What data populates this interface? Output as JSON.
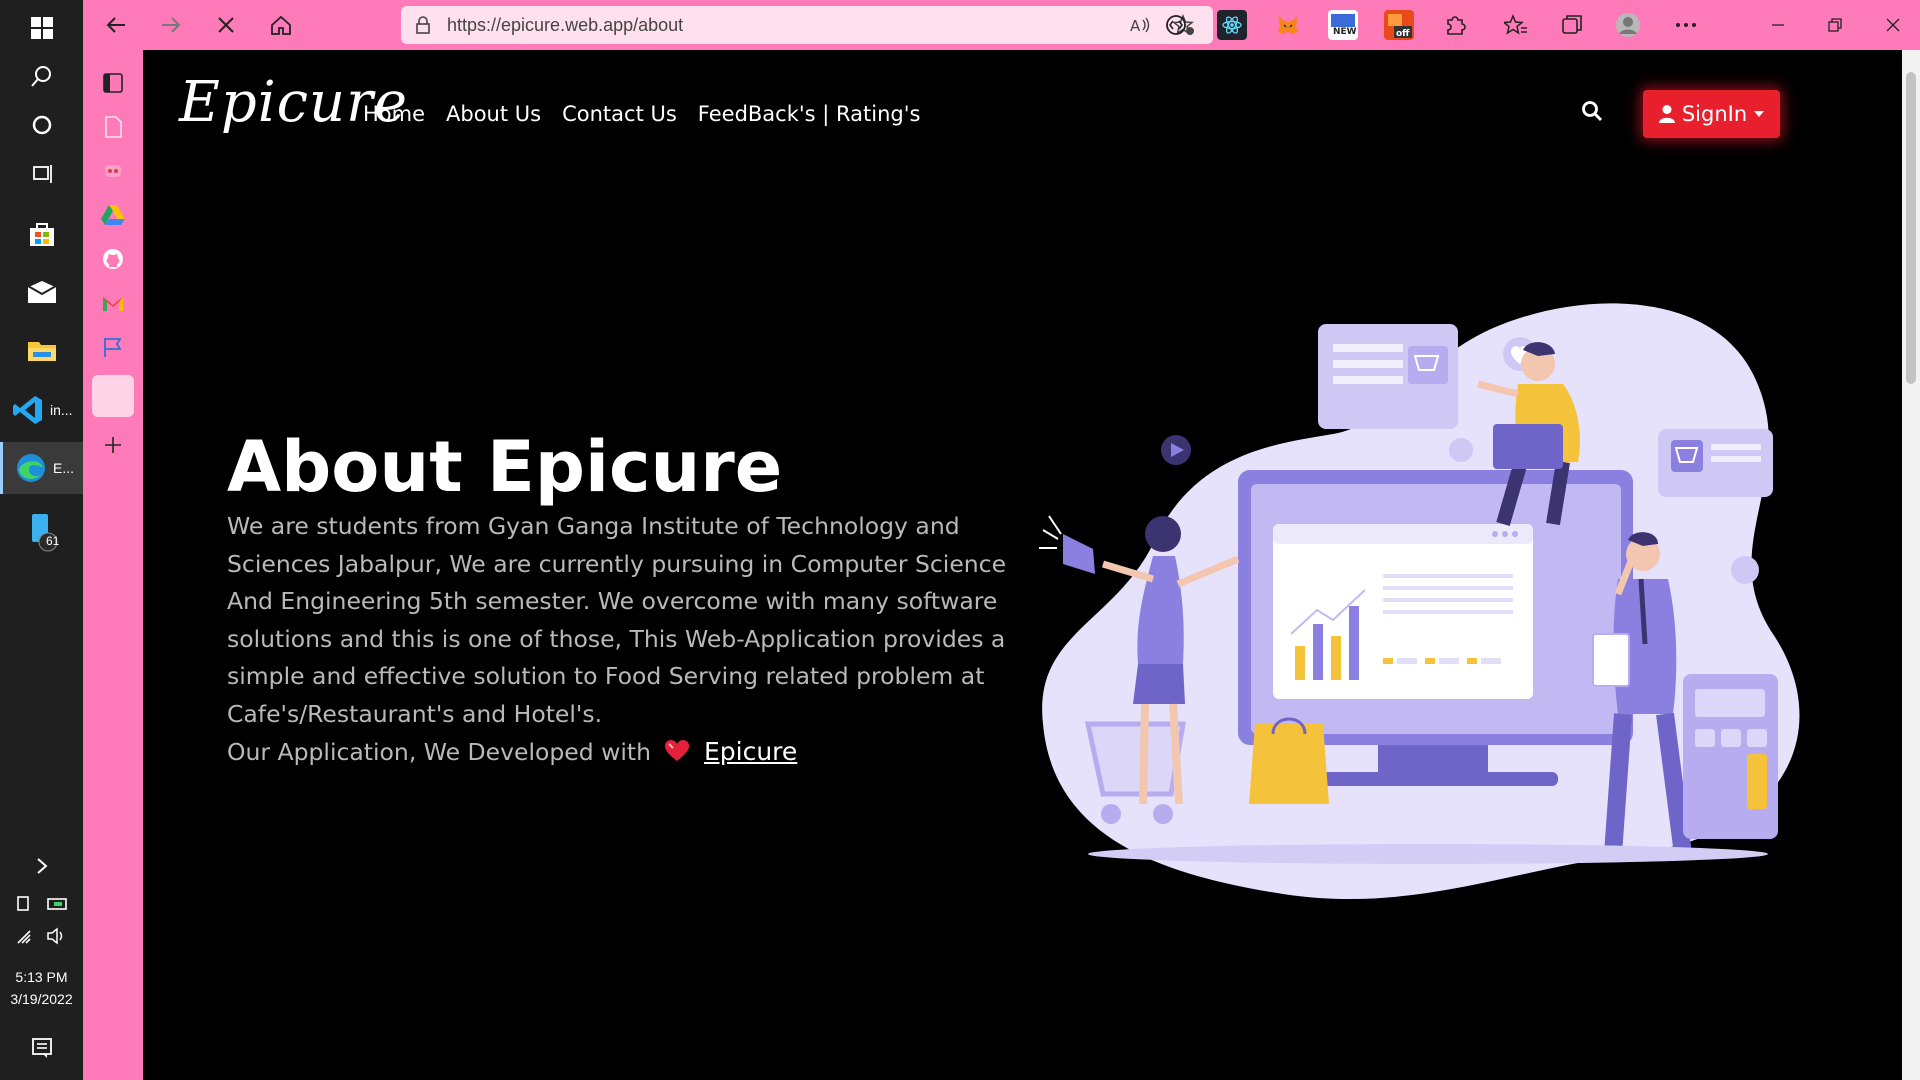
{
  "taskbar": {
    "apps": [
      {
        "label": "in..."
      },
      {
        "label": "E..."
      }
    ],
    "badge": "61",
    "time": "5:13 PM",
    "date": "3/19/2022"
  },
  "browser": {
    "url": "https://epicure.web.app/about",
    "extensions": [
      "NEW",
      "off"
    ]
  },
  "site": {
    "logo": "Epicure",
    "nav": [
      "Home",
      "About Us",
      "Contact Us",
      "FeedBack's | Rating's"
    ],
    "signin_label": "SignIn",
    "title": "About Epicure",
    "description": "We are students from Gyan Ganga Institute of Technology and Sciences Jabalpur, We are currently pursuing in Computer Science And Engineering 5th semester. We overcome with many software solutions and this is one of those, This Web-Application provides a simple and effective solution to Food Serving related problem at Cafe's/Restaurant's and Hotel's.",
    "developed_prefix": "Our Application, We Developed with",
    "brand_link": "Epicure"
  },
  "colors": {
    "browser_chrome": "#ff7ab8",
    "signin_button": "#e8202e",
    "page_background": "#000000",
    "illustration_primary": "#8b7fe0"
  }
}
